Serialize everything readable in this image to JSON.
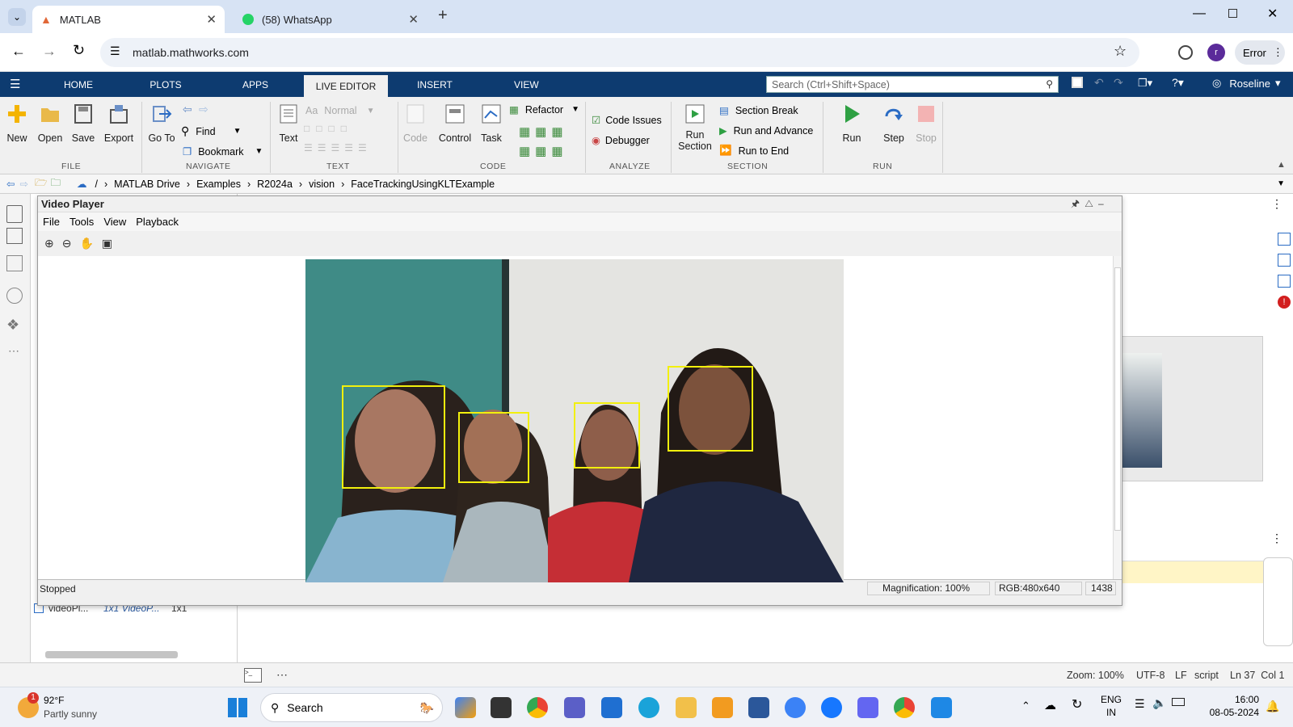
{
  "browser": {
    "tabs": [
      {
        "title": "MATLAB"
      },
      {
        "title": "(58) WhatsApp"
      }
    ],
    "url": "matlab.mathworks.com",
    "profile_initial": "r",
    "error_label": "Error"
  },
  "matlab": {
    "tabs": [
      "HOME",
      "PLOTS",
      "APPS",
      "LIVE EDITOR",
      "INSERT",
      "VIEW"
    ],
    "active_tab": "LIVE EDITOR",
    "search_placeholder": "Search (Ctrl+Shift+Space)",
    "user": "Roseline",
    "ribbon": {
      "file": {
        "new": "New",
        "open": "Open",
        "save": "Save",
        "export": "Export",
        "group": "FILE"
      },
      "navigate": {
        "goto_line1": "Go To",
        "find": "Find",
        "bookmark": "Bookmark",
        "group": "NAVIGATE"
      },
      "text": {
        "text": "Text",
        "style": "Normal",
        "group": "TEXT"
      },
      "code": {
        "code": "Code",
        "control": "Control",
        "task": "Task",
        "refactor": "Refactor",
        "group": "CODE"
      },
      "analyze": {
        "code_issues": "Code Issues",
        "debugger": "Debugger",
        "group": "ANALYZE"
      },
      "section": {
        "run_section_l1": "Run",
        "run_section_l2": "Section",
        "section_break": "Section Break",
        "run_and_advance": "Run and Advance",
        "run_to_end": "Run to End",
        "group": "SECTION"
      },
      "run": {
        "run": "Run",
        "step": "Step",
        "stop": "Stop",
        "group": "RUN"
      }
    },
    "path": [
      "/",
      "MATLAB Drive",
      "Examples",
      "R2024a",
      "vision",
      "FaceTrackingUsingKLTExample"
    ],
    "workspace_row": {
      "name": "videoPl...",
      "value": "1x1 VideoP...",
      "size": "1x1"
    },
    "status": {
      "zoom": "Zoom: 100%",
      "encoding": "UTF-8",
      "eol": "LF",
      "type": "script",
      "position": "Ln 37  Col 1"
    }
  },
  "video_player": {
    "title": "Video Player",
    "menu": [
      "File",
      "Tools",
      "View",
      "Playback"
    ],
    "status": "Stopped",
    "magnification": "Magnification: 100%",
    "rgb": "RGB:480x640",
    "frame": "1438",
    "box_color": "#f2f00d"
  },
  "taskbar": {
    "weather_temp": "92°F",
    "weather_desc": "Partly sunny",
    "weather_badge": "1",
    "search": "Search",
    "lang_line1": "ENG",
    "lang_line2": "IN",
    "time": "16:00",
    "date": "08-05-2024"
  }
}
